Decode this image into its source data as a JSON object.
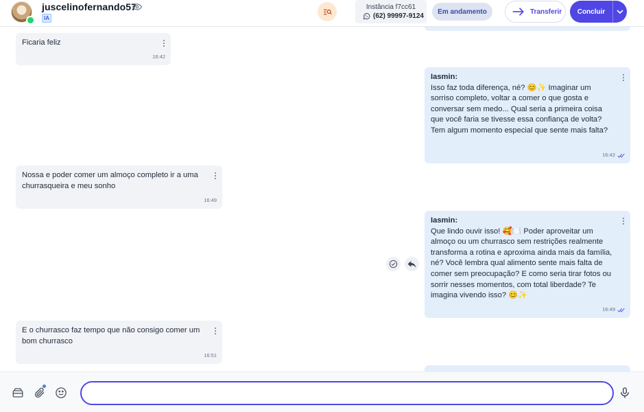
{
  "header": {
    "contact_name": "juscelinofernando57",
    "ia_badge": "IA",
    "instance_label": "Instância f7cc61",
    "instance_phone": "(62) 99997-9124",
    "status": "Em andamento",
    "transfer_label": "Transferir",
    "conclude_label": "Concluir"
  },
  "messages": [
    {
      "direction": "in",
      "text": "Ficaria feliz",
      "time": "16:42"
    },
    {
      "direction": "out",
      "sender": "Iasmin:",
      "text": "Isso faz toda diferença, né? 😊✨ Imaginar um sorriso completo, voltar a comer o que gosta e conversar sem medo... Qual seria a primeira coisa que você faria se tivesse essa confiança de volta? Tem algum momento especial que sente mais falta?",
      "time": "16:42"
    },
    {
      "direction": "in",
      "text": "Nossa e poder comer um almoço completo ir a uma churrasqueira e meu sonho",
      "time": "16:49"
    },
    {
      "direction": "out",
      "sender": "Iasmin:",
      "text": "Que lindo ouvir isso! 🥰🍽️ Poder aproveitar um almoço ou um churrasco sem restrições realmente transforma a rotina e aproxima ainda mais da família, né? Você lembra qual alimento sente mais falta de comer sem preocupação? E como seria tirar fotos ou sorrir nesses momentos, com total liberdade? Te imagina vivendo isso? 😊✨",
      "time": "16:49"
    },
    {
      "direction": "in",
      "text": "E o churrasco faz tempo que não consigo comer um bom churrasco",
      "time": "16:51"
    }
  ],
  "composer": {
    "value": ""
  },
  "colors": {
    "accent": "#4f46e5",
    "incoming_bg": "#f1f3f7",
    "outgoing_bg": "#e3eefb",
    "status_pill_bg": "#dde3f1"
  },
  "icons": [
    "eye-icon",
    "search-user-icon",
    "whatsapp-icon",
    "arrow-right-icon",
    "chevron-down-icon",
    "more-vertical-icon",
    "double-check-icon",
    "check-circle-icon",
    "reply-icon",
    "archive-icon",
    "paperclip-icon",
    "smile-icon",
    "microphone-icon"
  ]
}
